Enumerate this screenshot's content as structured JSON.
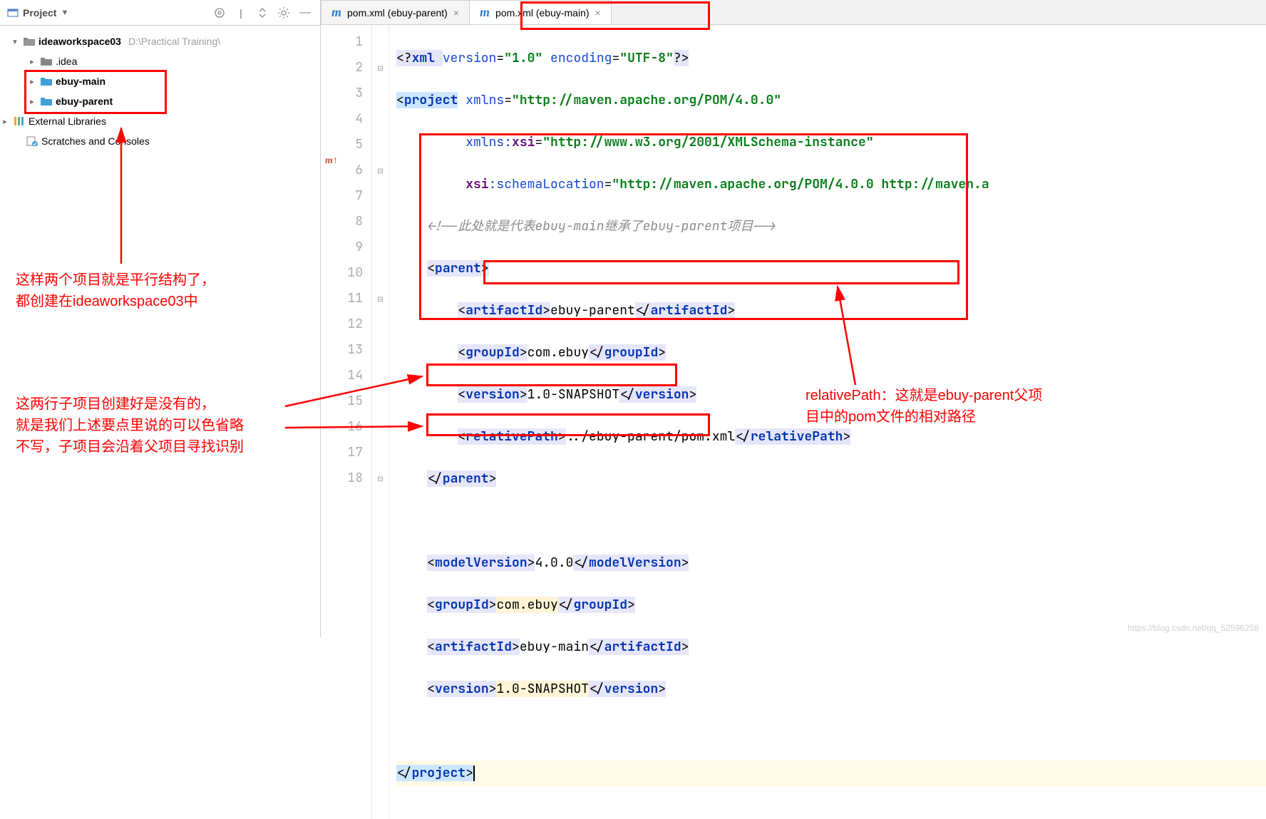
{
  "sidebar": {
    "title": "Project",
    "root": {
      "name": "ideaworkspace03",
      "path": "D:\\Practical Training\\"
    },
    "nodes": [
      {
        "name": ".idea",
        "icon": "folder"
      },
      {
        "name": "ebuy-main",
        "icon": "folder-blue",
        "bold": true
      },
      {
        "name": "ebuy-parent",
        "icon": "folder-blue",
        "bold": true
      }
    ],
    "ext_lib": "External Libraries",
    "scratches": "Scratches and Consoles"
  },
  "tabs": [
    {
      "label": "pom.xml (ebuy-parent)"
    },
    {
      "label": "pom.xml (ebuy-main)",
      "active": true
    }
  ],
  "code": {
    "lines": [
      1,
      2,
      3,
      4,
      5,
      6,
      7,
      8,
      9,
      10,
      11,
      12,
      13,
      14,
      15,
      16,
      17,
      18
    ],
    "l1_pi_open": "<?",
    "l1_pi_kw": "xml ",
    "l1_a1": "version",
    "l1_eq": "=",
    "l1_v1": "\"1.0\"",
    "l1_sp": " ",
    "l1_a2": "encoding",
    "l1_v2": "\"UTF-8\"",
    "l1_pi_close": "?>",
    "l2_open": "<",
    "l2_tag": "project",
    "l2_sp": " ",
    "l2_xmlns": "xmlns",
    "l2_eq": "=",
    "l2_val": "\"http://maven.apache.org/POM/4.0.0\"",
    "l3_ns": "xmlns:",
    "l3_xsi": "xsi",
    "l3_eq": "=",
    "l3_val": "\"http://www.w3.org/2001/XMLSchema-instance\"",
    "l4_pre": "xsi",
    "l4_attr": ":schemaLocation",
    "l4_eq": "=",
    "l4_val": "\"http://maven.apache.org/POM/4.0.0 http://maven.a",
    "l5_cm": "<!--此处就是代表ebuy-main继承了ebuy-parent项目-->",
    "l6_open": "<",
    "l6_tag": "parent",
    "l6_close": ">",
    "l7_open": "<",
    "l7_tag": "artifactId",
    "l7_mid": ">",
    "l7_val": "ebuy-parent",
    "l7_end": "</",
    "l7_tag2": "artifactId",
    "l7_fin": ">",
    "l8_open": "<",
    "l8_tag": "groupId",
    "l8_mid": ">",
    "l8_val": "com.ebuy",
    "l8_end": "</",
    "l8_tag2": "groupId",
    "l8_fin": ">",
    "l9_open": "<",
    "l9_tag": "version",
    "l9_mid": ">",
    "l9_val": "1.0-SNAPSHOT",
    "l9_end": "</",
    "l9_tag2": "version",
    "l9_fin": ">",
    "l10_open": "<",
    "l10_tag": "relativePath",
    "l10_mid": ">",
    "l10_val": "../ebuy-parent/pom.xml",
    "l10_end": "</",
    "l10_tag2": "relativePath",
    "l10_fin": ">",
    "l11_open": "</",
    "l11_tag": "parent",
    "l11_close": ">",
    "l13_open": "<",
    "l13_tag": "modelVersion",
    "l13_mid": ">",
    "l13_val": "4.0.0",
    "l13_end": "</",
    "l13_tag2": "modelVersion",
    "l13_fin": ">",
    "l14_open": "<",
    "l14_tag": "groupId",
    "l14_mid": ">",
    "l14_val": "com.ebuy",
    "l14_end": "</",
    "l14_tag2": "groupId",
    "l14_fin": ">",
    "l15_open": "<",
    "l15_tag": "artifactId",
    "l15_mid": ">",
    "l15_val": "ebuy-main",
    "l15_end": "</",
    "l15_tag2": "artifactId",
    "l15_fin": ">",
    "l16_open": "<",
    "l16_tag": "version",
    "l16_mid": ">",
    "l16_val": "1.0-SNAPSHOT",
    "l16_end": "</",
    "l16_tag2": "version",
    "l16_fin": ">",
    "l18_open": "</",
    "l18_tag": "project",
    "l18_close": ">"
  },
  "gutter_marker": "m↑",
  "annotations": {
    "a1": "这样两个项目就是平行结构了，\n都创建在ideaworkspace03中",
    "a2": "这两行子项目创建好是没有的，\n就是我们上述要点里说的可以色省略\n不写，子项目会沿着父项目寻找识别",
    "a3": "relativePath：这就是ebuy-parent父项\n目中的pom文件的相对路径"
  },
  "watermark": "https://blog.csdn.net/qq_52596258"
}
